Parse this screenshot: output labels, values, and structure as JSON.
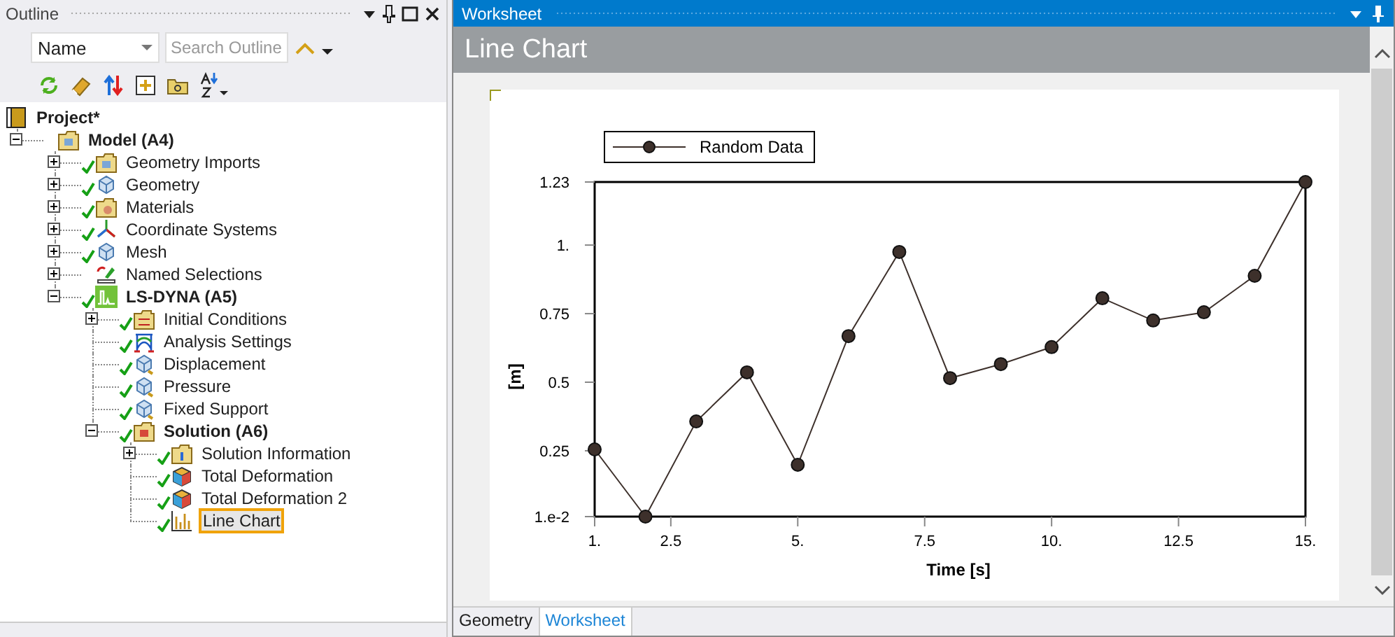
{
  "outline": {
    "title": "Outline",
    "filter": {
      "value": "Name"
    },
    "search": {
      "placeholder": "Search Outline"
    },
    "tree": [
      {
        "label": "Project*",
        "kind": "project",
        "bold": true,
        "checked": false,
        "selected": false,
        "children": [
          {
            "label": "Model (A4)",
            "kind": "model",
            "bold": true,
            "checked": false,
            "expanded": true,
            "selected": false,
            "children": [
              {
                "label": "Geometry Imports",
                "kind": "import-folder",
                "bold": false,
                "checked": true,
                "expanded": false,
                "selected": false
              },
              {
                "label": "Geometry",
                "kind": "geometry",
                "bold": false,
                "checked": true,
                "expanded": false,
                "selected": false
              },
              {
                "label": "Materials",
                "kind": "materials",
                "bold": false,
                "checked": true,
                "expanded": false,
                "selected": false
              },
              {
                "label": "Coordinate Systems",
                "kind": "axes",
                "bold": false,
                "checked": true,
                "expanded": false,
                "selected": false
              },
              {
                "label": "Mesh",
                "kind": "mesh",
                "bold": false,
                "checked": true,
                "expanded": false,
                "selected": false
              },
              {
                "label": "Named Selections",
                "kind": "selection",
                "bold": false,
                "checked": false,
                "expanded": false,
                "selected": false
              },
              {
                "label": "LS-DYNA (A5)",
                "kind": "analysis",
                "bold": true,
                "checked": true,
                "expanded": true,
                "selected": false,
                "children": [
                  {
                    "label": "Initial Conditions",
                    "kind": "initial",
                    "bold": false,
                    "checked": true,
                    "expanded": false,
                    "selected": false
                  },
                  {
                    "label": "Analysis Settings",
                    "kind": "settings",
                    "bold": false,
                    "checked": true,
                    "selected": false
                  },
                  {
                    "label": "Displacement",
                    "kind": "load",
                    "bold": false,
                    "checked": true,
                    "selected": false
                  },
                  {
                    "label": "Pressure",
                    "kind": "load",
                    "bold": false,
                    "checked": true,
                    "selected": false
                  },
                  {
                    "label": "Fixed Support",
                    "kind": "load",
                    "bold": false,
                    "checked": true,
                    "selected": false
                  },
                  {
                    "label": "Solution (A6)",
                    "kind": "solution",
                    "bold": true,
                    "checked": true,
                    "expanded": true,
                    "selected": false,
                    "children": [
                      {
                        "label": "Solution Information",
                        "kind": "info",
                        "bold": false,
                        "checked": true,
                        "expanded": false,
                        "selected": false
                      },
                      {
                        "label": "Total Deformation",
                        "kind": "result",
                        "bold": false,
                        "checked": true,
                        "selected": false
                      },
                      {
                        "label": "Total Deformation 2",
                        "kind": "result",
                        "bold": false,
                        "checked": true,
                        "selected": false
                      },
                      {
                        "label": "Line Chart",
                        "kind": "chart",
                        "bold": false,
                        "checked": true,
                        "selected": true
                      }
                    ]
                  }
                ]
              }
            ]
          }
        ]
      }
    ]
  },
  "worksheet": {
    "title": "Worksheet",
    "heading": "Line Chart",
    "chart_data": {
      "type": "line",
      "xlabel": "Time [s]",
      "ylabel": "[m]",
      "x": [
        1,
        2,
        3,
        4,
        5,
        6,
        7,
        8,
        9,
        10,
        11,
        12,
        13,
        14,
        15
      ],
      "series": [
        {
          "name": "Random Data",
          "color": "#3d302b",
          "marker": "circle",
          "values": [
            0.255,
            0.01,
            0.357,
            0.536,
            0.199,
            0.668,
            0.975,
            0.515,
            0.566,
            0.628,
            0.806,
            0.725,
            0.755,
            0.888,
            1.23
          ]
        }
      ],
      "xlim": [
        1,
        15
      ],
      "ylim": [
        0.01,
        1.23
      ],
      "xticks": [
        {
          "value": 1,
          "label": "1."
        },
        {
          "value": 2.5,
          "label": "2.5"
        },
        {
          "value": 5,
          "label": "5."
        },
        {
          "value": 7.5,
          "label": "7.5"
        },
        {
          "value": 10,
          "label": "10."
        },
        {
          "value": 12.5,
          "label": "12.5"
        },
        {
          "value": 15,
          "label": "15."
        }
      ],
      "yticks": [
        {
          "value": 0.01,
          "label": "1.e-2"
        },
        {
          "value": 0.25,
          "label": "0.25"
        },
        {
          "value": 0.5,
          "label": "0.5"
        },
        {
          "value": 0.75,
          "label": "0.75"
        },
        {
          "value": 1,
          "label": "1."
        },
        {
          "value": 1.23,
          "label": "1.23"
        }
      ]
    },
    "tabs": [
      {
        "label": "Geometry",
        "selected": false
      },
      {
        "label": "Worksheet",
        "selected": true
      }
    ]
  }
}
